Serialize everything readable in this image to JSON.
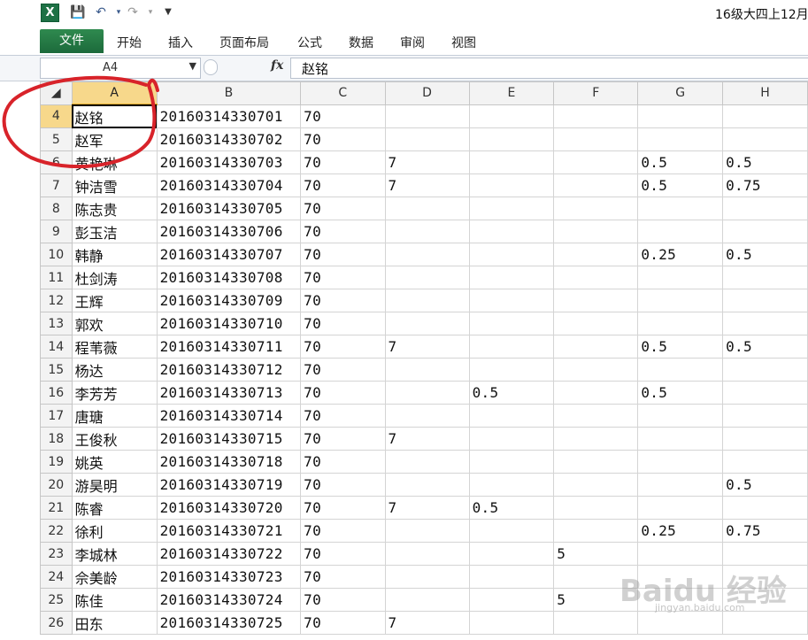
{
  "titlebar": {
    "title": "16级大四上12月"
  },
  "qat": {
    "app_icon": "excel-icon",
    "save_icon": "save-icon",
    "undo_icon": "undo-icon",
    "redo_icon": "redo-icon",
    "customize_icon": "dropdown-icon"
  },
  "ribbon": {
    "file": "文件",
    "tabs": [
      "开始",
      "插入",
      "页面布局",
      "公式",
      "数据",
      "审阅",
      "视图"
    ]
  },
  "formula_bar": {
    "name_box": "A4",
    "fx_label": "fx",
    "value": "赵铭"
  },
  "sheet": {
    "columns": [
      "A",
      "B",
      "C",
      "D",
      "E",
      "F",
      "G",
      "H"
    ],
    "rows": [
      {
        "n": "4",
        "A": "赵铭",
        "B": "20160314330701",
        "C": "70",
        "D": "",
        "E": "",
        "F": "",
        "G": "",
        "H": ""
      },
      {
        "n": "5",
        "A": "赵军",
        "B": "20160314330702",
        "C": "70",
        "D": "",
        "E": "",
        "F": "",
        "G": "",
        "H": ""
      },
      {
        "n": "6",
        "A": "黄艳琳",
        "B": "20160314330703",
        "C": "70",
        "D": "7",
        "E": "",
        "F": "",
        "G": "0.5",
        "H": "0.5"
      },
      {
        "n": "7",
        "A": "钟洁雪",
        "B": "20160314330704",
        "C": "70",
        "D": "7",
        "E": "",
        "F": "",
        "G": "0.5",
        "H": "0.75"
      },
      {
        "n": "8",
        "A": "陈志贵",
        "B": "20160314330705",
        "C": "70",
        "D": "",
        "E": "",
        "F": "",
        "G": "",
        "H": ""
      },
      {
        "n": "9",
        "A": "彭玉洁",
        "B": "20160314330706",
        "C": "70",
        "D": "",
        "E": "",
        "F": "",
        "G": "",
        "H": ""
      },
      {
        "n": "10",
        "A": "韩静",
        "B": "20160314330707",
        "C": "70",
        "D": "",
        "E": "",
        "F": "",
        "G": "0.25",
        "H": "0.5"
      },
      {
        "n": "11",
        "A": "杜剑涛",
        "B": "20160314330708",
        "C": "70",
        "D": "",
        "E": "",
        "F": "",
        "G": "",
        "H": ""
      },
      {
        "n": "12",
        "A": "王辉",
        "B": "20160314330709",
        "C": "70",
        "D": "",
        "E": "",
        "F": "",
        "G": "",
        "H": ""
      },
      {
        "n": "13",
        "A": "郭欢",
        "B": "20160314330710",
        "C": "70",
        "D": "",
        "E": "",
        "F": "",
        "G": "",
        "H": ""
      },
      {
        "n": "14",
        "A": "程苇薇",
        "B": "20160314330711",
        "C": "70",
        "D": "7",
        "E": "",
        "F": "",
        "G": "0.5",
        "H": "0.5"
      },
      {
        "n": "15",
        "A": "杨达",
        "B": "20160314330712",
        "C": "70",
        "D": "",
        "E": "",
        "F": "",
        "G": "",
        "H": ""
      },
      {
        "n": "16",
        "A": "李芳芳",
        "B": "20160314330713",
        "C": "70",
        "D": "",
        "E": "0.5",
        "F": "",
        "G": "0.5",
        "H": ""
      },
      {
        "n": "17",
        "A": "唐瑭",
        "B": "20160314330714",
        "C": "70",
        "D": "",
        "E": "",
        "F": "",
        "G": "",
        "H": ""
      },
      {
        "n": "18",
        "A": "王俊秋",
        "B": "20160314330715",
        "C": "70",
        "D": "7",
        "E": "",
        "F": "",
        "G": "",
        "H": ""
      },
      {
        "n": "19",
        "A": "姚英",
        "B": "20160314330718",
        "C": "70",
        "D": "",
        "E": "",
        "F": "",
        "G": "",
        "H": ""
      },
      {
        "n": "20",
        "A": "游昊明",
        "B": "20160314330719",
        "C": "70",
        "D": "",
        "E": "",
        "F": "",
        "G": "",
        "H": "0.5"
      },
      {
        "n": "21",
        "A": "陈睿",
        "B": "20160314330720",
        "C": "70",
        "D": "7",
        "E": "0.5",
        "F": "",
        "G": "",
        "H": ""
      },
      {
        "n": "22",
        "A": "徐利",
        "B": "20160314330721",
        "C": "70",
        "D": "",
        "E": "",
        "F": "",
        "G": "0.25",
        "H": "0.75"
      },
      {
        "n": "23",
        "A": "李城林",
        "B": "20160314330722",
        "C": "70",
        "D": "",
        "E": "",
        "F": "5",
        "G": "",
        "H": ""
      },
      {
        "n": "24",
        "A": "佘美龄",
        "B": "20160314330723",
        "C": "70",
        "D": "",
        "E": "",
        "F": "",
        "G": "",
        "H": ""
      },
      {
        "n": "25",
        "A": "陈佳",
        "B": "20160314330724",
        "C": "70",
        "D": "",
        "E": "",
        "F": "5",
        "G": "",
        "H": ""
      },
      {
        "n": "26",
        "A": "田东",
        "B": "20160314330725",
        "C": "70",
        "D": "7",
        "E": "",
        "F": "",
        "G": "",
        "H": ""
      }
    ]
  },
  "colors": {
    "file_tab": "#217346",
    "selected_header": "#f7d88b",
    "annotation": "#d8232a"
  },
  "watermark": {
    "brand": "Baidu 经验",
    "url": "jingyan.baidu.com"
  }
}
